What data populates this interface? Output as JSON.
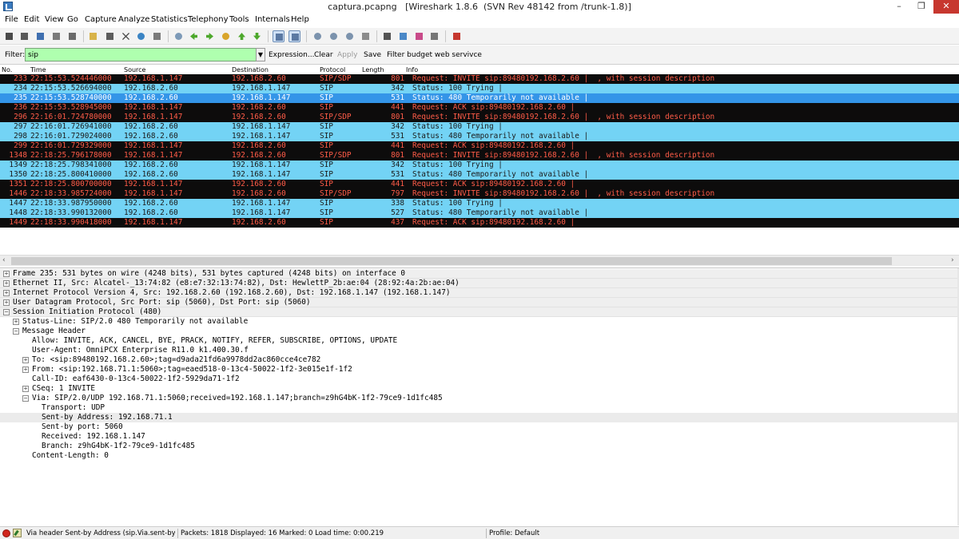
{
  "window": {
    "title": "captura.pcapng   [Wireshark 1.8.6  (SVN Rev 48142 from /trunk-1.8)]",
    "btn_min": "–",
    "btn_max": "❐",
    "btn_close": "✕"
  },
  "menu": [
    "File",
    "Edit",
    "View",
    "Go",
    "Capture",
    "Analyze",
    "Statistics",
    "Telephony",
    "Tools",
    "Internals",
    "Help"
  ],
  "toolbar_icons": [
    "interface-list-icon",
    "capture-options-icon",
    "start-capture-icon",
    "stop-capture-icon",
    "restart-capture-icon",
    "open-file-icon",
    "save-file-icon",
    "close-file-icon",
    "reload-icon",
    "print-icon",
    "find-packet-icon",
    "go-back-icon",
    "go-forward-icon",
    "go-to-packet-icon",
    "go-first-icon",
    "go-last-icon",
    "colorize-icon",
    "auto-scroll-icon",
    "zoom-in-icon",
    "zoom-out-icon",
    "normal-size-icon",
    "resize-columns-icon",
    "capture-filters-icon",
    "display-filters-icon",
    "coloring-rules-icon",
    "preferences-icon",
    "help-icon"
  ],
  "filter": {
    "label": "Filter:",
    "value": "sip",
    "expression": "Expression...",
    "clear": "Clear",
    "apply": "Apply",
    "save": "Save",
    "budget": "Filter budget web servivce"
  },
  "packet_list": {
    "columns": {
      "no": "No.",
      "time": "Time",
      "source": "Source",
      "destination": "Destination",
      "protocol": "Protocol",
      "length": "Length",
      "info": "Info"
    },
    "rows": [
      {
        "no": "233",
        "time": "22:15:53.524446000",
        "source": "192.168.1.147",
        "destination": "192.168.2.60",
        "protocol": "SIP/SDP",
        "length": "801",
        "info": "Request: INVITE sip:89480192.168.2.60 |  , with session description",
        "style": "dark"
      },
      {
        "no": "234",
        "time": "22:15:53.526694000",
        "source": "192.168.2.60",
        "destination": "192.168.1.147",
        "protocol": "SIP",
        "length": "342",
        "info": "Status: 100 Trying |",
        "style": "light"
      },
      {
        "no": "235",
        "time": "22:15:53.528740000",
        "source": "192.168.2.60",
        "destination": "192.168.1.147",
        "protocol": "SIP",
        "length": "531",
        "info": "Status: 480 Temporarily not available |",
        "style": "selected"
      },
      {
        "no": "236",
        "time": "22:15:53.528945000",
        "source": "192.168.1.147",
        "destination": "192.168.2.60",
        "protocol": "SIP",
        "length": "441",
        "info": "Request: ACK sip:89480192.168.2.60 |",
        "style": "dark"
      },
      {
        "no": "296",
        "time": "22:16:01.724780000",
        "source": "192.168.1.147",
        "destination": "192.168.2.60",
        "protocol": "SIP/SDP",
        "length": "801",
        "info": "Request: INVITE sip:89480192.168.2.60 |  , with session description",
        "style": "dark"
      },
      {
        "no": "297",
        "time": "22:16:01.726941000",
        "source": "192.168.2.60",
        "destination": "192.168.1.147",
        "protocol": "SIP",
        "length": "342",
        "info": "Status: 100 Trying |",
        "style": "light"
      },
      {
        "no": "298",
        "time": "22:16:01.729024000",
        "source": "192.168.2.60",
        "destination": "192.168.1.147",
        "protocol": "SIP",
        "length": "531",
        "info": "Status: 480 Temporarily not available |",
        "style": "light"
      },
      {
        "no": "299",
        "time": "22:16:01.729329000",
        "source": "192.168.1.147",
        "destination": "192.168.2.60",
        "protocol": "SIP",
        "length": "441",
        "info": "Request: ACK sip:89480192.168.2.60 |",
        "style": "dark"
      },
      {
        "no": "1348",
        "time": "22:18:25.796178000",
        "source": "192.168.1.147",
        "destination": "192.168.2.60",
        "protocol": "SIP/SDP",
        "length": "801",
        "info": "Request: INVITE sip:89480192.168.2.60 |  , with session description",
        "style": "dark"
      },
      {
        "no": "1349",
        "time": "22:18:25.798341000",
        "source": "192.168.2.60",
        "destination": "192.168.1.147",
        "protocol": "SIP",
        "length": "342",
        "info": "Status: 100 Trying |",
        "style": "light"
      },
      {
        "no": "1350",
        "time": "22:18:25.800410000",
        "source": "192.168.2.60",
        "destination": "192.168.1.147",
        "protocol": "SIP",
        "length": "531",
        "info": "Status: 480 Temporarily not available |",
        "style": "light"
      },
      {
        "no": "1351",
        "time": "22:18:25.800700000",
        "source": "192.168.1.147",
        "destination": "192.168.2.60",
        "protocol": "SIP",
        "length": "441",
        "info": "Request: ACK sip:89480192.168.2.60 |",
        "style": "dark"
      },
      {
        "no": "1446",
        "time": "22:18:33.985724000",
        "source": "192.168.1.147",
        "destination": "192.168.2.60",
        "protocol": "SIP/SDP",
        "length": "797",
        "info": "Request: INVITE sip:89480192.168.2.60 |  , with session description",
        "style": "dark"
      },
      {
        "no": "1447",
        "time": "22:18:33.987950000",
        "source": "192.168.2.60",
        "destination": "192.168.1.147",
        "protocol": "SIP",
        "length": "338",
        "info": "Status: 100 Trying |",
        "style": "light"
      },
      {
        "no": "1448",
        "time": "22:18:33.990132000",
        "source": "192.168.2.60",
        "destination": "192.168.1.147",
        "protocol": "SIP",
        "length": "527",
        "info": "Status: 480 Temporarily not available |",
        "style": "light"
      },
      {
        "no": "1449",
        "time": "22:18:33.990418000",
        "source": "192.168.1.147",
        "destination": "192.168.2.60",
        "protocol": "SIP",
        "length": "437",
        "info": "Request: ACK sip:89480192.168.2.60 |",
        "style": "dark"
      }
    ]
  },
  "details": [
    {
      "depth": 0,
      "expander": "+",
      "text": "Frame 235: 531 bytes on wire (4248 bits), 531 bytes captured (4248 bits) on interface 0",
      "style": "sec"
    },
    {
      "depth": 0,
      "expander": "+",
      "text": "Ethernet II, Src: Alcatel-_13:74:82 (e8:e7:32:13:74:82), Dst: HewlettP_2b:ae:04 (28:92:4a:2b:ae:04)",
      "style": "sec"
    },
    {
      "depth": 0,
      "expander": "+",
      "text": "Internet Protocol Version 4, Src: 192.168.2.60 (192.168.2.60), Dst: 192.168.1.147 (192.168.1.147)",
      "style": "sec"
    },
    {
      "depth": 0,
      "expander": "+",
      "text": "User Datagram Protocol, Src Port: sip (5060), Dst Port: sip (5060)",
      "style": "sec"
    },
    {
      "depth": 0,
      "expander": "−",
      "text": "Session Initiation Protocol (480)",
      "style": "sec"
    },
    {
      "depth": 1,
      "expander": "+",
      "text": "Status-Line: SIP/2.0 480 Temporarily not available",
      "style": ""
    },
    {
      "depth": 1,
      "expander": "−",
      "text": "Message Header",
      "style": ""
    },
    {
      "depth": 2,
      "expander": "",
      "text": "Allow: INVITE, ACK, CANCEL, BYE, PRACK, NOTIFY, REFER, SUBSCRIBE, OPTIONS, UPDATE",
      "style": ""
    },
    {
      "depth": 2,
      "expander": "",
      "text": "User-Agent: OmniPCX Enterprise R11.0 k1.400.30.f",
      "style": ""
    },
    {
      "depth": 2,
      "expander": "+",
      "text": "To: <sip:89480192.168.2.60>;tag=d9ada21fd6a9978dd2ac860cce4ce782",
      "style": ""
    },
    {
      "depth": 2,
      "expander": "+",
      "text": "From: <sip:192.168.71.1:5060>;tag=eaed518-0-13c4-50022-1f2-3e015e1f-1f2",
      "style": ""
    },
    {
      "depth": 2,
      "expander": "",
      "text": "Call-ID: eaf6430-0-13c4-50022-1f2-5929da71-1f2",
      "style": ""
    },
    {
      "depth": 2,
      "expander": "+",
      "text": "CSeq: 1 INVITE",
      "style": ""
    },
    {
      "depth": 2,
      "expander": "−",
      "text": "Via: SIP/2.0/UDP 192.168.71.1:5060;received=192.168.1.147;branch=z9hG4bK-1f2-79ce9-1d1fc485",
      "style": ""
    },
    {
      "depth": 3,
      "expander": "",
      "text": "Transport: UDP",
      "style": ""
    },
    {
      "depth": 3,
      "expander": "",
      "text": "Sent-by Address: 192.168.71.1",
      "style": "hl"
    },
    {
      "depth": 3,
      "expander": "",
      "text": "Sent-by port: 5060",
      "style": ""
    },
    {
      "depth": 3,
      "expander": "",
      "text": "Received: 192.168.1.147",
      "style": ""
    },
    {
      "depth": 3,
      "expander": "",
      "text": "Branch: z9hG4bK-1f2-79ce9-1d1fc485",
      "style": ""
    },
    {
      "depth": 2,
      "expander": "",
      "text": "Content-Length: 0",
      "style": ""
    }
  ],
  "status": {
    "field_info": "Via header Sent-by Address (sip.Via.sent-by....",
    "packets": "Packets: 1818 Displayed: 16 Marked: 0 Load time: 0:00.219",
    "profile": "Profile: Default"
  },
  "colors": {
    "dark_row_bg": "#0d0c0c",
    "dark_row_fg": "#ff5c48",
    "light_row_bg": "#73d3f5",
    "selected_row_bg": "#3495e8",
    "filter_ok_bg": "#afffaf"
  }
}
